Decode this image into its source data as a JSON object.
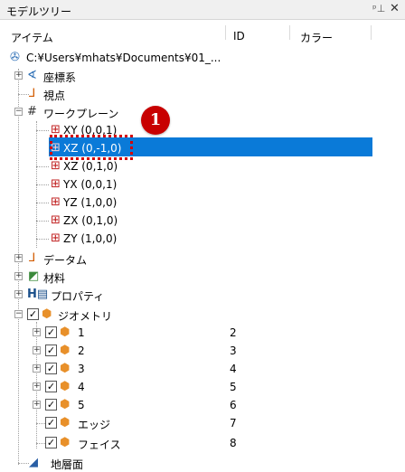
{
  "panel": {
    "title": "モデルツリー",
    "pin_icon": "pin-icon",
    "close_icon": "close-icon"
  },
  "columns": {
    "item": "アイテム",
    "id": "ID",
    "color": "カラー"
  },
  "callout_number": "1",
  "tree": {
    "root": "C:¥Users¥mhats¥Documents¥01_...",
    "coord": "座標系",
    "viewpoint": "視点",
    "workplane": "ワークプレーン",
    "planes": [
      "XY (0,0,1)",
      "XZ (0,-1,0)",
      "XZ (0,1,0)",
      "YX (0,0,1)",
      "YZ (1,0,0)",
      "ZX (0,1,0)",
      "ZY (1,0,0)"
    ],
    "selected_plane_index": 1,
    "datum": "データム",
    "material": "材料",
    "property": "プロパティ",
    "geometry": "ジオメトリ",
    "geometry_items": [
      {
        "label": "1",
        "id": "2"
      },
      {
        "label": "2",
        "id": "3"
      },
      {
        "label": "3",
        "id": "4"
      },
      {
        "label": "4",
        "id": "5"
      },
      {
        "label": "5",
        "id": "6"
      },
      {
        "label": "エッジ",
        "id": "7"
      },
      {
        "label": "フェイス",
        "id": "8"
      }
    ],
    "ground": "地層面"
  }
}
